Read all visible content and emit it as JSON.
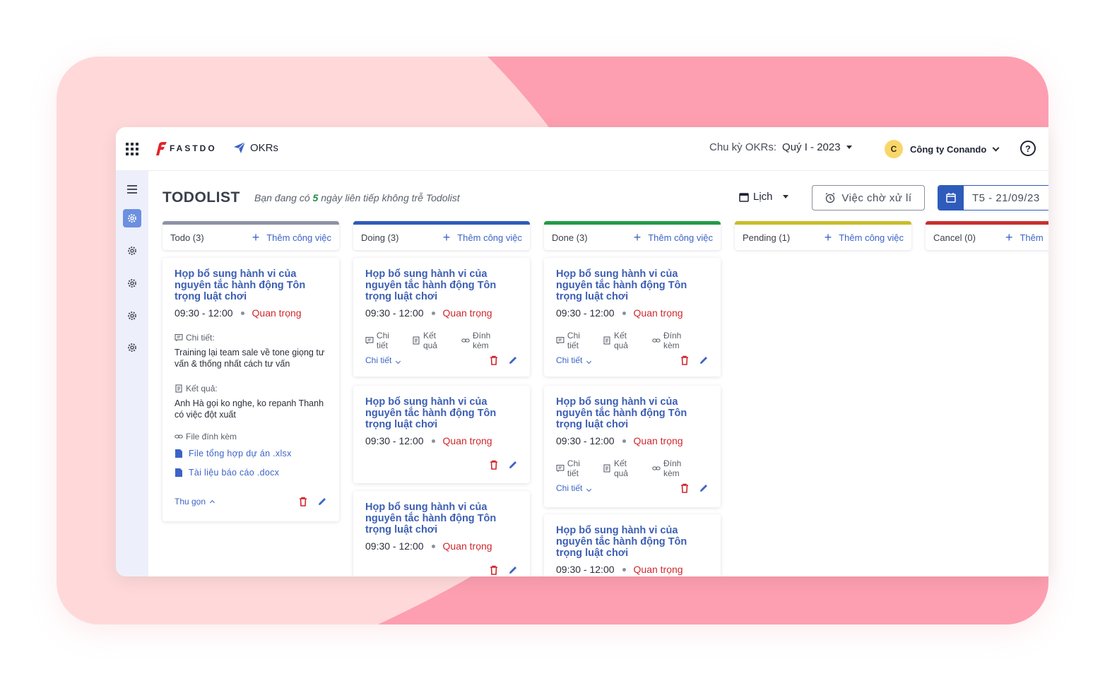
{
  "brand": {
    "name": "FASTDO",
    "module": "OKRs"
  },
  "header": {
    "cycle_label": "Chu kỳ OKRs:",
    "cycle_value": "Quý I - 2023",
    "company_initial": "C",
    "company_name": "Công ty Conando",
    "help": "?"
  },
  "page": {
    "title": "TODOLIST",
    "streak_prefix": "Bạn đang có",
    "streak_count": "5",
    "streak_suffix": "ngày liên tiếp không trễ Todolist",
    "view_label": "Lịch",
    "pending_label": "Việc chờ xử lí",
    "date_label": "T5 - 21/09/23"
  },
  "columns": [
    {
      "title": "Todo (3)",
      "add": "Thêm công việc",
      "color": "#8d93a6"
    },
    {
      "title": "Doing (3)",
      "add": "Thêm công việc",
      "color": "#2f5bbb"
    },
    {
      "title": "Done (3)",
      "add": "Thêm công việc",
      "color": "#239a4a"
    },
    {
      "title": "Pending (1)",
      "add": "Thêm công việc",
      "color": "#c9bd2b"
    },
    {
      "title": "Cancel (0)",
      "add": "Thêm",
      "color": "#c8302f"
    }
  ],
  "card": {
    "title": "Họp bổ sung hành vi của nguyên tắc hành động Tôn trọng luật chơi",
    "time": "09:30 - 12:00",
    "priority": "Quan trọng",
    "meta_detail": "Chi tiết",
    "meta_result": "Kết quả",
    "meta_attach": "Đính kèm",
    "expand": "Chi tiết",
    "collapse": "Thu gọn"
  },
  "expanded": {
    "detail_label": "Chi tiết:",
    "detail_text": "Training lại team sale về tone giọng tư vấn & thống nhất cách tư vấn",
    "result_label": "Kết quả:",
    "result_text": "Anh Hà gọi ko nghe, ko repanh Thanh có việc đột xuất",
    "files_label": "File đính kèm",
    "files": [
      "File tổng hợp dự án .xlsx",
      "Tài liệu báo cáo .docx"
    ]
  },
  "colors": {
    "primary": "#2f5bbb",
    "danger": "#d0272c",
    "bg_pink": "#ffd9da",
    "bg_rose": "#fd9fb0"
  }
}
